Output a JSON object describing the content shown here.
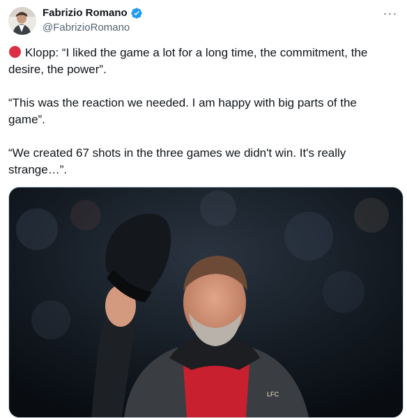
{
  "author": {
    "display_name": "Fabrizio Romano",
    "handle": "@FabrizioRomano",
    "verified": true,
    "avatar_icon": "profile-photo"
  },
  "menu": {
    "more_label": "···"
  },
  "tweet": {
    "paragraphs": [
      "Klopp: “I liked the game a lot for a long time, the commitment, the desire, the power”.",
      "“This was the reaction we needed. I am happy with big parts of the game”.",
      "“We created 67 shots in the three games we didn't win. It's really strange…”."
    ],
    "lead_icon": "red-circle",
    "lead_icon_color": "#dd2e44"
  },
  "media": {
    "badge_text": "LFC",
    "description_colors": {
      "background": "#0c1218",
      "jacket_red": "#c8202f",
      "jacket_grey": "#3a3d42"
    }
  },
  "colors": {
    "text": "#0f1419",
    "secondary": "#536471",
    "verified": "#1d9bf0"
  }
}
